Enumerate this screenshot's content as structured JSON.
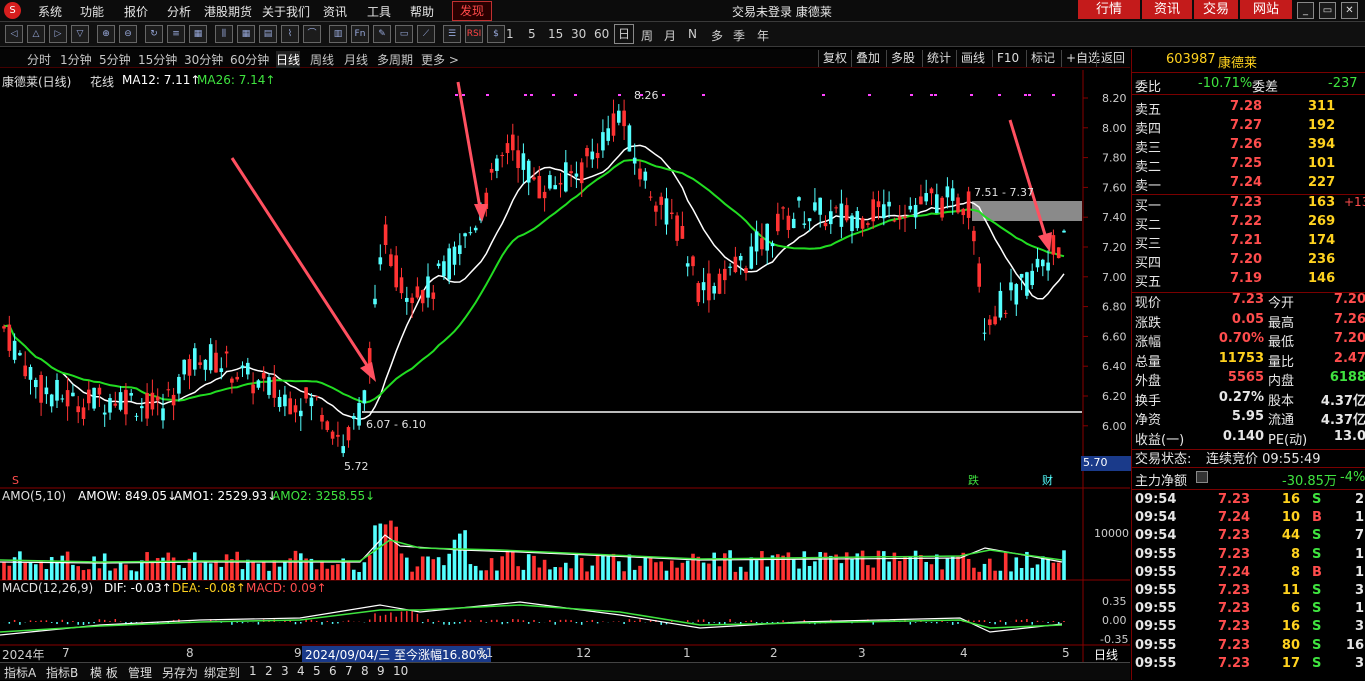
{
  "menubar": {
    "logo": "S",
    "items": [
      "系统",
      "功能",
      "报价",
      "分析",
      "港股期货",
      "关于我们",
      "资讯",
      "工具",
      "帮助"
    ],
    "highlight": "发现",
    "title": "交易未登录 康德莱",
    "buttons": [
      "行情",
      "资讯",
      "交易",
      "网站"
    ],
    "win": [
      "_",
      "▭",
      "□",
      "✕"
    ]
  },
  "toolbar": {
    "icons": [
      "arrow-left",
      "arrow-up",
      "arrow-right",
      "arrow-down",
      "zoom-in",
      "zoom-out",
      "refresh",
      "list",
      "grid",
      "column",
      "grid2",
      "table",
      "tick",
      "minute",
      "chart-k",
      "fundamentals",
      "tools",
      "document",
      "chart-line",
      "list2",
      "rsi",
      "dollar",
      "money",
      "scan",
      "graph",
      "chart-trend",
      "grid3",
      "f5",
      "f6"
    ],
    "rsi": "RSI",
    "f5": "F5",
    "periods": [
      "1",
      "5",
      "15",
      "30",
      "60"
    ],
    "day": "日",
    "others": [
      "周",
      "月",
      "N",
      "多",
      "季",
      "年"
    ]
  },
  "period_bar": {
    "items": [
      "分时",
      "1分钟",
      "5分钟",
      "15分钟",
      "30分钟",
      "60分钟",
      "日线",
      "周线",
      "月线",
      "多周期",
      "更多 >"
    ],
    "active": "日线",
    "right": [
      "复权",
      "叠加",
      "多股",
      "统计",
      "画线",
      "F10",
      "标记",
      "+自选",
      "返回"
    ]
  },
  "legend": {
    "name": "康德莱(日线)",
    "ind": "花线",
    "ma12": "MA12: 7.11↑",
    "ma26": "MA26: 7.14↑"
  },
  "price_axis": [
    "8.20",
    "8.00",
    "7.80",
    "7.60",
    "7.40",
    "7.20",
    "7.00",
    "6.80",
    "6.60",
    "6.40",
    "6.20",
    "6.00"
  ],
  "low_price_badge": "5.70",
  "annotations": {
    "high": "8.26",
    "low": "5.72",
    "range1": "6.07 - 6.10",
    "range2": "7.51 - 7.37",
    "die": "跌",
    "cai": "财",
    "s_mark": "S"
  },
  "amo": {
    "title": "AMO(5,10)",
    "amow": "AMOW: 849.05↓",
    "amo1": "AMO1: 2529.93↓",
    "amo2": "AMO2: 3258.55↓",
    "tick": "10000"
  },
  "macd": {
    "title": "MACD(12,26,9)",
    "dif": "DIF: -0.03↑",
    "dea": "DEA: -0.08↑",
    "macd": "MACD: 0.09↑",
    "ticks": [
      "0.35",
      "0.00",
      "-0.35"
    ]
  },
  "date_axis": {
    "labels": [
      "2024年",
      "7",
      "8",
      "9",
      "11",
      "12",
      "1",
      "2",
      "3",
      "4",
      "5"
    ],
    "cursor": "2024/09/04/三  至今涨幅16.80%",
    "period": "日线"
  },
  "bottom_tabs": [
    "指标A",
    "指标B",
    "模 板",
    "管理",
    "另存为",
    "绑定到",
    "1",
    "2",
    "3",
    "4",
    "5",
    "6",
    "7",
    "8",
    "9",
    "10"
  ],
  "quote": {
    "code": "603987",
    "name": "康德莱",
    "weibi_label": "委比",
    "weibi": "-10.71%",
    "weicha_label": "委差",
    "weicha": "-237",
    "sells": [
      {
        "label": "卖五",
        "price": "7.28",
        "vol": "311"
      },
      {
        "label": "卖四",
        "price": "7.27",
        "vol": "192"
      },
      {
        "label": "卖三",
        "price": "7.26",
        "vol": "394"
      },
      {
        "label": "卖二",
        "price": "7.25",
        "vol": "101"
      },
      {
        "label": "卖一",
        "price": "7.24",
        "vol": "227"
      }
    ],
    "buys": [
      {
        "label": "买一",
        "price": "7.23",
        "vol": "163",
        "chg": "+13"
      },
      {
        "label": "买二",
        "price": "7.22",
        "vol": "269",
        "chg": ""
      },
      {
        "label": "买三",
        "price": "7.21",
        "vol": "174",
        "chg": ""
      },
      {
        "label": "买四",
        "price": "7.20",
        "vol": "236",
        "chg": ""
      },
      {
        "label": "买五",
        "price": "7.19",
        "vol": "146",
        "chg": ""
      }
    ],
    "stats": [
      {
        "l1": "现价",
        "v1": "7.23",
        "l2": "今开",
        "v2": "7.20",
        "c1": "#ff4d4d",
        "c2": "#ff4d4d"
      },
      {
        "l1": "涨跌",
        "v1": "0.05",
        "l2": "最高",
        "v2": "7.26",
        "c1": "#ff4d4d",
        "c2": "#ff4d4d"
      },
      {
        "l1": "涨幅",
        "v1": "0.70%",
        "l2": "最低",
        "v2": "7.20",
        "c1": "#ff4d4d",
        "c2": "#ff4d4d"
      },
      {
        "l1": "总量",
        "v1": "11753",
        "l2": "量比",
        "v2": "2.47",
        "c1": "#ffd21f",
        "c2": "#ff4d4d"
      },
      {
        "l1": "外盘",
        "v1": "5565",
        "l2": "内盘",
        "v2": "6188",
        "c1": "#ff4d4d",
        "c2": "#3fe33f"
      },
      {
        "l1": "换手",
        "v1": "0.27%",
        "l2": "股本",
        "v2": "4.37亿",
        "c1": "#e6e6e6",
        "c2": "#e6e6e6"
      },
      {
        "l1": "净资",
        "v1": "5.95",
        "l2": "流通",
        "v2": "4.37亿",
        "c1": "#e6e6e6",
        "c2": "#e6e6e6"
      },
      {
        "l1": "收益(一)",
        "v1": "0.140",
        "l2": "PE(动)",
        "v2": "13.0",
        "c1": "#e6e6e6",
        "c2": "#e6e6e6"
      }
    ],
    "status_label": "交易状态:",
    "status": "连续竞价 09:55:49",
    "zhuli_label": "主力净额",
    "zhuli": "-30.85万",
    "zhuli_pct": "-4%",
    "ticks": [
      {
        "t": "09:54",
        "p": "7.23",
        "v": "16",
        "s": "S",
        "n": "2"
      },
      {
        "t": "09:54",
        "p": "7.24",
        "v": "10",
        "s": "B",
        "n": "1"
      },
      {
        "t": "09:54",
        "p": "7.23",
        "v": "44",
        "s": "S",
        "n": "7"
      },
      {
        "t": "09:55",
        "p": "7.23",
        "v": "8",
        "s": "S",
        "n": "1"
      },
      {
        "t": "09:55",
        "p": "7.24",
        "v": "8",
        "s": "B",
        "n": "1"
      },
      {
        "t": "09:55",
        "p": "7.23",
        "v": "11",
        "s": "S",
        "n": "3"
      },
      {
        "t": "09:55",
        "p": "7.23",
        "v": "6",
        "s": "S",
        "n": "1"
      },
      {
        "t": "09:55",
        "p": "7.23",
        "v": "16",
        "s": "S",
        "n": "3"
      },
      {
        "t": "09:55",
        "p": "7.23",
        "v": "80",
        "s": "S",
        "n": "16"
      },
      {
        "t": "09:55",
        "p": "7.23",
        "v": "17",
        "s": "S",
        "n": "3"
      }
    ]
  },
  "colors": {
    "up": "#ff3333",
    "down": "#54ffff",
    "ma12": "#ffffff",
    "ma26": "#22dd22",
    "accent": "#c41b1b",
    "purple": "#ff44ff",
    "yellow": "#ffd21f"
  }
}
